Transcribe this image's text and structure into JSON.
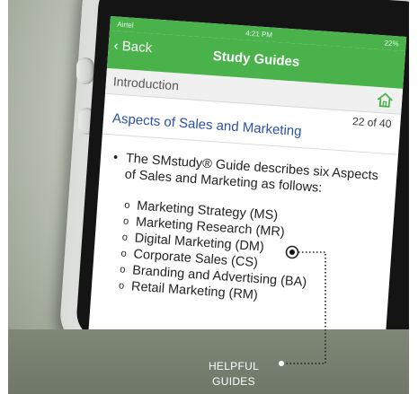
{
  "status_bar": {
    "carrier": "Airtel",
    "time": "4:21 PM",
    "battery": "22%"
  },
  "nav": {
    "back_label": "Back",
    "title": "Study Guides"
  },
  "breadcrumb": {
    "label": "Introduction"
  },
  "page": {
    "counter": "22 of 40",
    "section_title": "Aspects of Sales and Marketing"
  },
  "content": {
    "intro": "The SMstudy® Guide describes six Aspects of Sales and Marketing as follows:",
    "items": [
      "Marketing Strategy (MS)",
      "Marketing Research (MR)",
      "Digital Marketing (DM)",
      "Corporate Sales (CS)",
      "Branding and Advertising (BA)",
      "Retail Marketing (RM)"
    ]
  },
  "callout": {
    "line1": "HELPFUL",
    "line2": "GUIDES"
  },
  "colors": {
    "accent": "#49b24b",
    "link": "#2a52a7"
  },
  "icons": {
    "home": "home-icon",
    "back": "chevron-left-icon"
  }
}
